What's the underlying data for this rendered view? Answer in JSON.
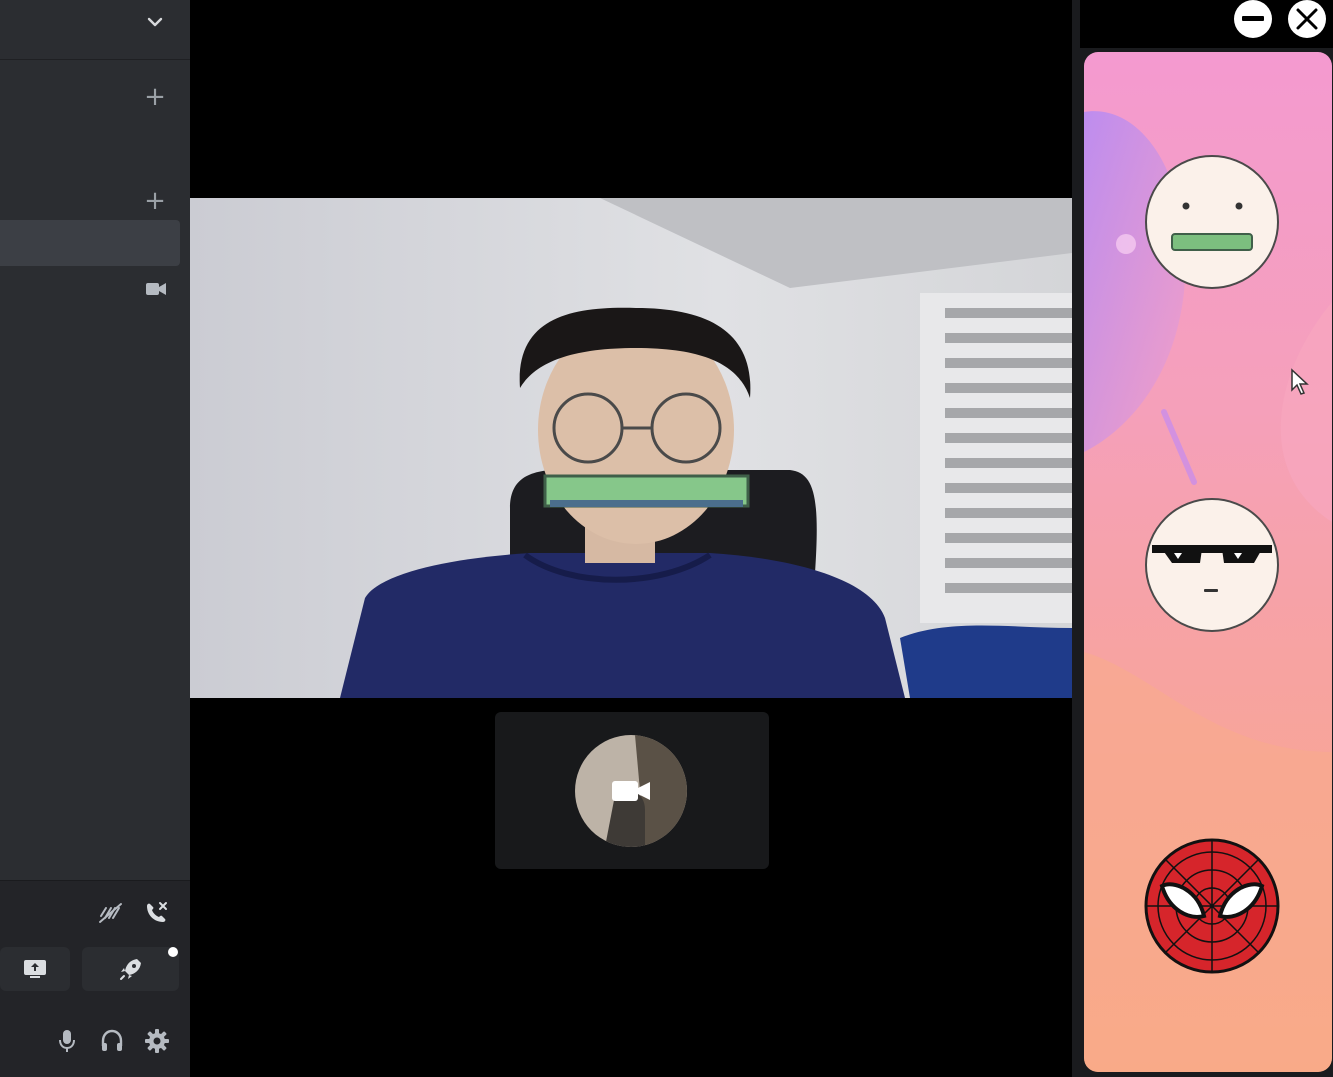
{
  "sidebar": {
    "header_title": "",
    "icons": {
      "chevron": "chevron-down-icon",
      "add_1": "plus-icon",
      "add_2": "plus-icon",
      "camera": "video-camera-icon",
      "noise": "noise-suppression-icon",
      "disconnect": "phone-disconnect-icon",
      "screen": "screen-share-icon",
      "activity": "rocket-icon",
      "mic": "microphone-icon",
      "headset": "headphones-icon",
      "settings": "gear-icon"
    },
    "voice_status_label": ""
  },
  "stage": {
    "main_video": "webcam-feed",
    "thumbnail_icon": "video-camera-icon"
  },
  "panel": {
    "minimize_icon": "minimize-icon",
    "close_icon": "close-icon",
    "stickers": [
      {
        "name": "mouth-bar-face-sticker"
      },
      {
        "name": "sunglasses-face-sticker"
      },
      {
        "name": "spiderman-mask-sticker"
      }
    ],
    "colors": {
      "gradient_top": "#f49ad0",
      "gradient_mid": "#f7a3a1",
      "gradient_bottom": "#f9a783"
    }
  },
  "colors": {
    "sidebar_bg": "#2b2d31",
    "stage_bg": "#000000",
    "accent_green": "#86c78a"
  }
}
